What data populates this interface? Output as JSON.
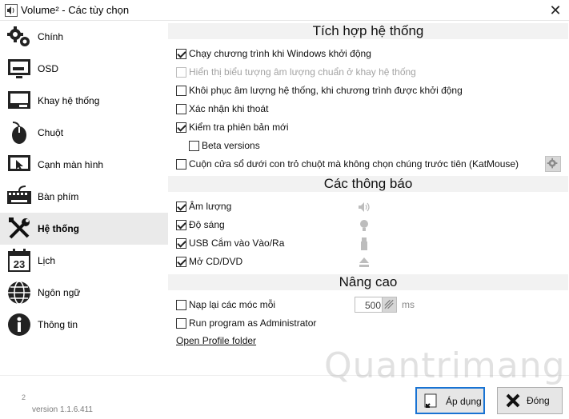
{
  "window": {
    "title": "Volume² - Các tùy chọn",
    "icon": "speaker-app-icon"
  },
  "sidebar": {
    "items": [
      {
        "label": "Chính",
        "icon": "gears-icon"
      },
      {
        "label": "OSD",
        "icon": "monitor-icon"
      },
      {
        "label": "Khay hệ thống",
        "icon": "tray-icon"
      },
      {
        "label": "Chuột",
        "icon": "mouse-icon"
      },
      {
        "label": "Cạnh màn hình",
        "icon": "screen-edge-icon"
      },
      {
        "label": "Bàn phím",
        "icon": "keyboard-icon"
      },
      {
        "label": "Hệ thống",
        "icon": "tools-icon",
        "active": true
      },
      {
        "label": "Lịch",
        "icon": "calendar-icon",
        "badge": "23"
      },
      {
        "label": "Ngôn ngữ",
        "icon": "globe-icon"
      },
      {
        "label": "Thông tin",
        "icon": "info-icon"
      }
    ]
  },
  "sections": {
    "integration": "Tích hợp hệ thống",
    "notifications": "Các thông báo",
    "advanced": "Nâng cao"
  },
  "integration": [
    {
      "label": "Chạy chương trình khi Windows khởi động",
      "checked": true
    },
    {
      "label": "Hiển thị biểu tượng âm lượng chuẩn ở khay hệ thống",
      "checked": false,
      "disabled": true
    },
    {
      "label": "Khôi phục âm lượng hệ thống, khi chương trình được khởi động",
      "checked": false
    },
    {
      "label": "Xác nhận khi thoát",
      "checked": false
    },
    {
      "label": "Kiểm tra phiên bản mới",
      "checked": true
    },
    {
      "label": "Beta versions",
      "checked": false
    },
    {
      "label": "Cuộn cửa sổ dưới con trỏ chuột mà không chọn chúng trước tiên (KatMouse)",
      "checked": false
    }
  ],
  "notifications": [
    {
      "label": "Âm lượng",
      "checked": true,
      "icon": "speaker-icon"
    },
    {
      "label": "Độ sáng",
      "checked": true,
      "icon": "bulb-icon"
    },
    {
      "label": "USB Cắm vào Vào/Ra",
      "checked": true,
      "icon": "usb-icon"
    },
    {
      "label": "Mở CD/DVD",
      "checked": true,
      "icon": "eject-icon"
    }
  ],
  "advanced": {
    "reload_hooks": {
      "label": "Nạp lại các móc mỗi",
      "checked": false,
      "value": "500",
      "unit": "ms"
    },
    "run_admin": {
      "label": "Run program as Administrator",
      "checked": false
    },
    "open_profile": "Open Profile folder"
  },
  "footer": {
    "version_sup": "2",
    "version": "version 1.1.6.411",
    "apply_label": "Áp dụng",
    "close_label": "Đóng",
    "watermark": "Quantrimang"
  },
  "colors": {
    "active_item_bg": "#eaeaea",
    "section_bg": "#f2f2f2",
    "primary_border": "#1873d3"
  }
}
